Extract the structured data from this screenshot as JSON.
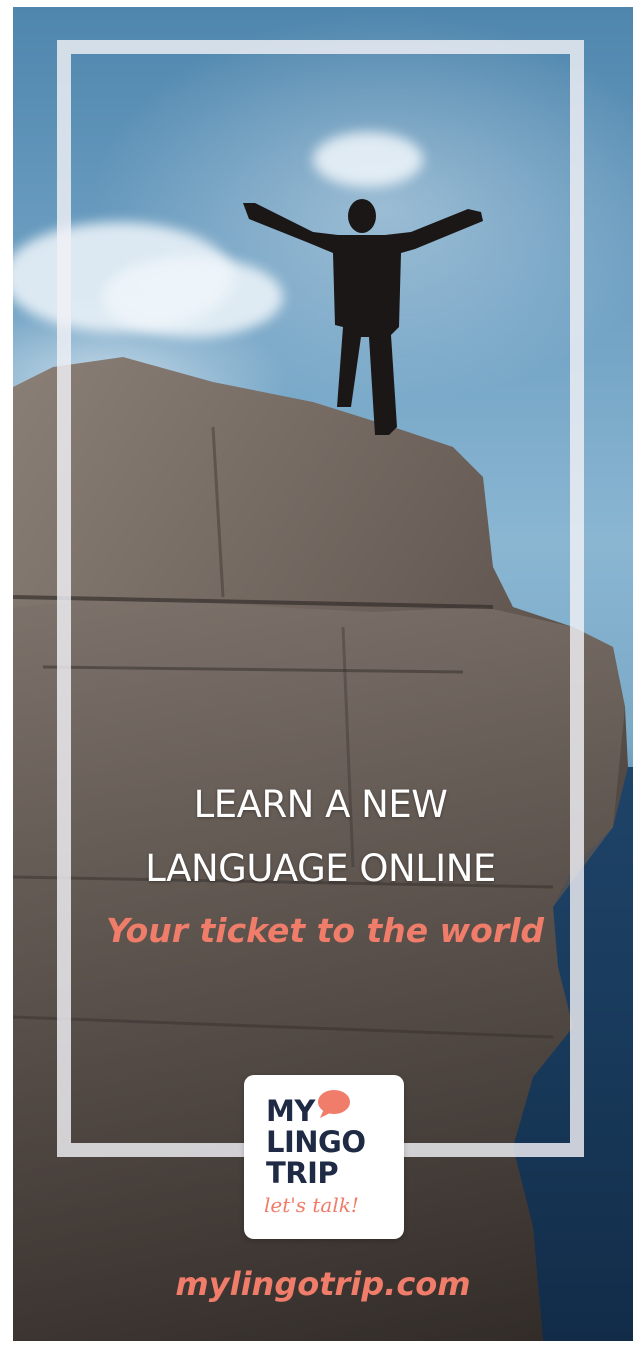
{
  "poster": {
    "headline_line1": "LEARN A NEW",
    "headline_line2": "LANGUAGE ONLINE",
    "tagline": "Your ticket to the world",
    "website": "mylingotrip.com"
  },
  "logo": {
    "line1": "MY",
    "line2": "LINGO",
    "line3": "TRIP",
    "subline": "let's talk!",
    "icon": "speech-bubble-icon"
  },
  "colors": {
    "accent": "#f07c6a",
    "logo_text": "#1f2a44",
    "frame": "#f0f0f5"
  }
}
